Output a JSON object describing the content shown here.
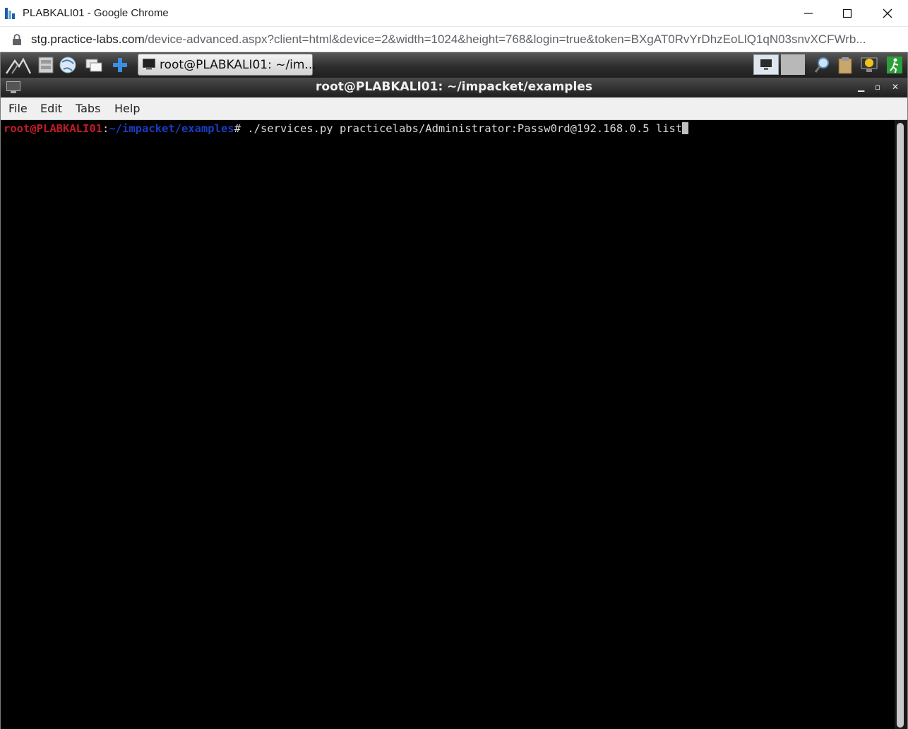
{
  "browser": {
    "window_title": "PLABKALI01 - Google Chrome",
    "url_host": "stg.practice-labs.com",
    "url_rest": "/device-advanced.aspx?client=html&device=2&width=1024&height=768&login=true&token=BXgAT0RvYrDhzEoLlQ1qN03snvXCFWrb..."
  },
  "panel": {
    "icons": [
      "kali-menu-icon",
      "file-manager-icon",
      "web-browser-icon",
      "show-desktop-icon",
      "add-icon"
    ],
    "task_label": "root@PLABKALI01: ~/im...",
    "tray_icons": [
      "search-icon",
      "clipboard-icon",
      "update-notifier-icon",
      "logout-icon"
    ]
  },
  "terminal": {
    "title": "root@PLABKALI01: ~/impacket/examples",
    "menu": [
      "File",
      "Edit",
      "Tabs",
      "Help"
    ],
    "prompt_user": "root@PLABKALI01",
    "prompt_sep": ":",
    "prompt_path": "~/impacket/examples",
    "prompt_symbol": "# ",
    "command": "./services.py practicelabs/Administrator:Passw0rd@192.168.0.5 list"
  },
  "colors": {
    "prompt_user": "#c01c28",
    "prompt_path": "#1a3cc0",
    "terminal_bg": "#000000",
    "terminal_fg": "#d9d9d9"
  }
}
